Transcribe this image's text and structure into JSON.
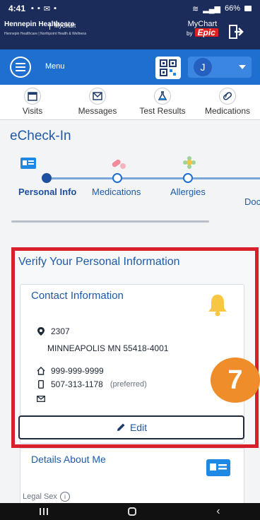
{
  "status": {
    "time": "4:41",
    "battery": "66%"
  },
  "brand": {
    "org_name": "Hennepin Healthcare",
    "org_tagline": "Hennepin Healthcare | Northpoint Health & Wellness",
    "mychart_small": "MyChart",
    "mychart_label": "MyChart",
    "by_label": "by",
    "epic_label": "Epic"
  },
  "menu": {
    "label": "Menu",
    "user_initial": "J"
  },
  "nav": [
    {
      "label": "Visits",
      "icon": "calendar-icon"
    },
    {
      "label": "Messages",
      "icon": "envelope-icon"
    },
    {
      "label": "Test Results",
      "icon": "flask-icon"
    },
    {
      "label": "Medications",
      "icon": "pill-icon"
    }
  ],
  "echeck": {
    "title": "eCheck-In",
    "steps": [
      {
        "label": "Personal Info",
        "active": true
      },
      {
        "label": "Medications",
        "active": false
      },
      {
        "label": "Allergies",
        "active": false
      },
      {
        "label": "Doc",
        "active": false
      }
    ]
  },
  "verify": {
    "title": "Verify Your Personal Information",
    "contact": {
      "title": "Contact Information",
      "street": "2307",
      "city_line": "MINNEAPOLIS MN 55418-4001",
      "home_phone": "999-999-9999",
      "mobile_phone": "507-313-1178",
      "preferred_label": "(preferred)"
    },
    "edit_label": "Edit",
    "step_badge": "7"
  },
  "details": {
    "title": "Details About Me",
    "legal_sex_label": "Legal Sex"
  },
  "colors": {
    "accent": "#1e6fd0",
    "header": "#1c2c5a",
    "highlight": "#d81f2c",
    "badge": "#ee8d2a"
  }
}
